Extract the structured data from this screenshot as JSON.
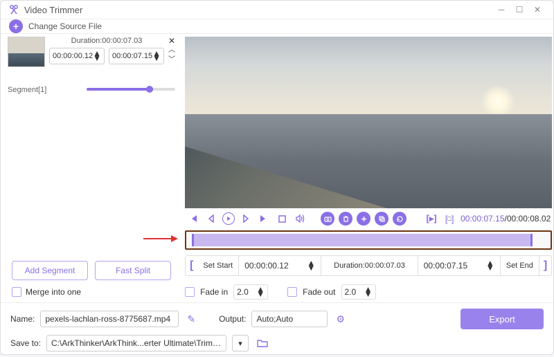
{
  "window": {
    "title": "Video Trimmer"
  },
  "topbar": {
    "change_source": "Change Source File"
  },
  "segment": {
    "duration_label": "Duration:00:00:07.03",
    "start": "00:00:00.12",
    "end": "00:00:07.15",
    "label": "Segment[1]"
  },
  "buttons": {
    "add_segment": "Add Segment",
    "fast_split": "Fast Split",
    "merge": "Merge into one",
    "export": "Export"
  },
  "player": {
    "current": "00:00:07.15",
    "total": "00:00:08.02"
  },
  "range": {
    "set_start": "Set Start",
    "start_val": "00:00:00.12",
    "duration": "Duration:00:00:07.03",
    "end_val": "00:00:07.15",
    "set_end": "Set End"
  },
  "fade": {
    "in_label": "Fade in",
    "in_val": "2.0",
    "out_label": "Fade out",
    "out_val": "2.0"
  },
  "file": {
    "name_label": "Name:",
    "name": "pexels-lachlan-ross-8775687.mp4",
    "output_label": "Output:",
    "output": "Auto;Auto",
    "save_label": "Save to:",
    "save_path": "C:\\ArkThinker\\ArkThink...erter Ultimate\\Trimmer"
  }
}
